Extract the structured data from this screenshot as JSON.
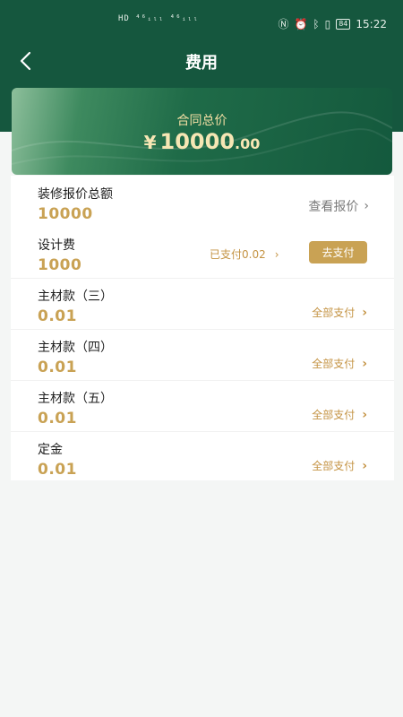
{
  "status_bar": {
    "left_text": "HD ⁴⁶ᵢₗₗ ⁴⁶ᵢₗₗ",
    "right_icons": [
      "nfc-icon",
      "alarm-icon",
      "bluetooth-icon",
      "vibrate-icon"
    ],
    "battery": "84",
    "time": "15:22"
  },
  "nav": {
    "title": "费用"
  },
  "contract": {
    "label": "合同总价",
    "currency": "¥",
    "amount_int": "10000",
    "amount_dec": ".00"
  },
  "items": [
    {
      "name": "装修报价总额",
      "amount": "10000",
      "action": "查看报价"
    },
    {
      "name": "设计费",
      "amount": "1000",
      "paid": "已支付0.02",
      "pay_label": "去支付"
    },
    {
      "name": "主材款（三）",
      "amount": "0.01",
      "action": "全部支付"
    },
    {
      "name": "主材款（四）",
      "amount": "0.01",
      "action": "全部支付"
    },
    {
      "name": "主材款（五）",
      "amount": "0.01",
      "action": "全部支付"
    },
    {
      "name": "定金",
      "amount": "0.01",
      "action": "全部支付"
    }
  ],
  "colors": {
    "brand_green": "#15573e",
    "gold": "#c9a254"
  }
}
